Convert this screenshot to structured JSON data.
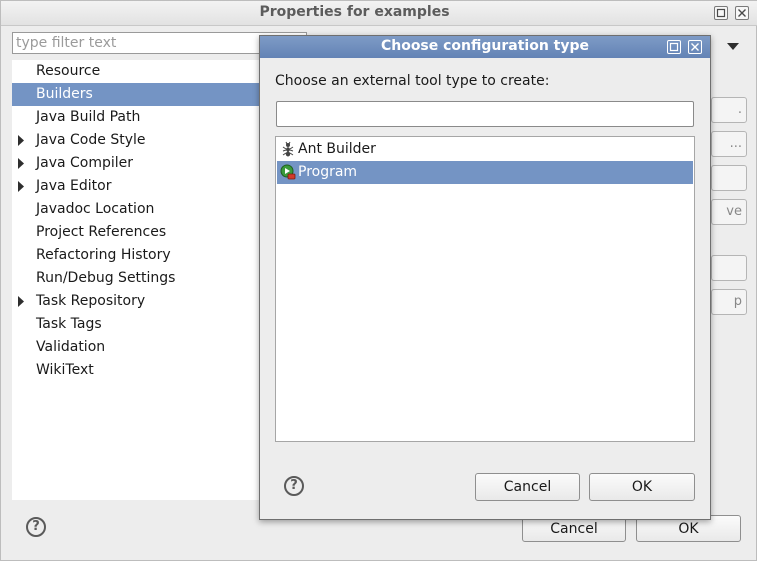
{
  "main": {
    "title": "Properties for examples",
    "filter_placeholder": "type filter text",
    "tree": [
      {
        "label": "Resource",
        "expandable": false,
        "selected": false
      },
      {
        "label": "Builders",
        "expandable": false,
        "selected": true
      },
      {
        "label": "Java Build Path",
        "expandable": false,
        "selected": false
      },
      {
        "label": "Java Code Style",
        "expandable": true,
        "selected": false
      },
      {
        "label": "Java Compiler",
        "expandable": true,
        "selected": false
      },
      {
        "label": "Java Editor",
        "expandable": true,
        "selected": false
      },
      {
        "label": "Javadoc Location",
        "expandable": false,
        "selected": false
      },
      {
        "label": "Project References",
        "expandable": false,
        "selected": false
      },
      {
        "label": "Refactoring History",
        "expandable": false,
        "selected": false
      },
      {
        "label": "Run/Debug Settings",
        "expandable": false,
        "selected": false
      },
      {
        "label": "Task Repository",
        "expandable": true,
        "selected": false
      },
      {
        "label": "Task Tags",
        "expandable": false,
        "selected": false
      },
      {
        "label": "Validation",
        "expandable": false,
        "selected": false
      },
      {
        "label": "WikiText",
        "expandable": false,
        "selected": false
      }
    ],
    "side_buttons": [
      ".",
      "...",
      "",
      "ve",
      "",
      "p"
    ],
    "cancel_label": "Cancel",
    "ok_label": "OK",
    "help_glyph": "?"
  },
  "dialog": {
    "title": "Choose configuration type",
    "prompt": "Choose an external tool type to create:",
    "filter_value": "",
    "types": [
      {
        "label": "Ant Builder",
        "icon": "ant-icon",
        "selected": false
      },
      {
        "label": "Program",
        "icon": "program-icon",
        "selected": true
      }
    ],
    "cancel_label": "Cancel",
    "ok_label": "OK",
    "help_glyph": "?"
  },
  "colors": {
    "selection": "#7494c4",
    "dialog_titlebar": "#6f8ebf",
    "window_bg": "#ededed"
  }
}
